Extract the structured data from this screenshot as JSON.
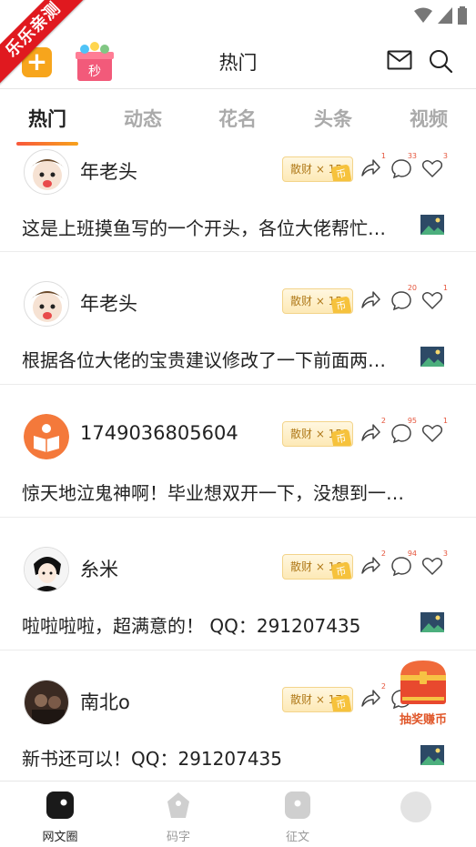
{
  "ribbon": "乐乐亲测",
  "header": {
    "title": "热门",
    "add_label": "+",
    "gift_label": "秒"
  },
  "tabs": [
    {
      "label": "热门",
      "active": true
    },
    {
      "label": "动态",
      "active": false
    },
    {
      "label": "花名",
      "active": false
    },
    {
      "label": "头条",
      "active": false
    },
    {
      "label": "视频",
      "active": false
    }
  ],
  "posts": [
    {
      "username": "年老头",
      "badge": "散财 × 15",
      "badge_coin": "币",
      "share_count": "1",
      "comment_count": "33",
      "like_count": "3",
      "text": "这是上班摸鱼写的一个开头，各位大佬帮忙…",
      "avatar": "cartoon-face-icon"
    },
    {
      "username": "年老头",
      "badge": "散财 × 15",
      "badge_coin": "币",
      "share_count": "",
      "comment_count": "20",
      "like_count": "1",
      "text": "根据各位大佬的宝贵建议修改了一下前面两…",
      "avatar": "cartoon-face-icon"
    },
    {
      "username": "1749036805604",
      "badge": "散财 × 152",
      "badge_coin": "币",
      "share_count": "2",
      "comment_count": "95",
      "like_count": "1",
      "text": "惊天地泣鬼神啊！毕业想双开一下，没想到一…",
      "avatar": "book-reader-icon"
    },
    {
      "username": "糸米",
      "badge": "散财 × 168",
      "badge_coin": "币",
      "share_count": "2",
      "comment_count": "94",
      "like_count": "3",
      "text": "啦啦啦啦，超满意的！ QQ：291207435",
      "avatar": "anime-avatar-icon"
    },
    {
      "username": "南北o",
      "badge": "散财 × 171",
      "badge_coin": "币",
      "share_count": "2",
      "comment_count": "",
      "like_count": "",
      "text": "新书还可以！QQ：291207435",
      "avatar": "photo-avatar-icon"
    }
  ],
  "lottery": {
    "label": "抽奖赚币"
  },
  "bottom_nav": [
    {
      "label": "网文圈",
      "active": true
    },
    {
      "label": "码字",
      "active": false
    },
    {
      "label": "征文",
      "active": false
    },
    {
      "label": "",
      "active": false
    }
  ],
  "colors": {
    "accent": "#f8583b",
    "badge_text": "#b07a1a",
    "ribbon": "#e0191f",
    "add_button": "#f7a51c"
  }
}
